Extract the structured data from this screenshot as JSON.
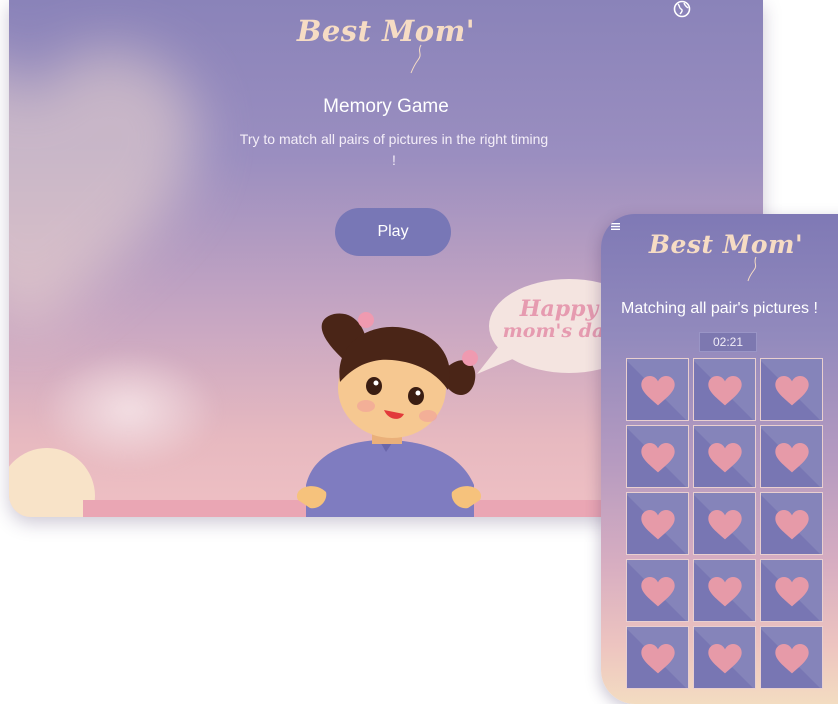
{
  "brand": {
    "logo": "Best Mom'"
  },
  "tablet": {
    "title": "Memory Game",
    "description": "Try to match all pairs of pictures in the right timing !",
    "play_label": "Play",
    "bubble_line1": "Happy",
    "bubble_line2": "mom's day"
  },
  "phone": {
    "title": "Matching all pair's pictures !",
    "timer": "02:21",
    "cards": [
      {
        "icon": "heart-icon"
      },
      {
        "icon": "heart-icon"
      },
      {
        "icon": "heart-icon"
      },
      {
        "icon": "heart-icon"
      },
      {
        "icon": "heart-icon"
      },
      {
        "icon": "heart-icon"
      },
      {
        "icon": "heart-icon"
      },
      {
        "icon": "heart-icon"
      },
      {
        "icon": "heart-icon"
      },
      {
        "icon": "heart-icon"
      },
      {
        "icon": "heart-icon"
      },
      {
        "icon": "heart-icon"
      },
      {
        "icon": "heart-icon"
      },
      {
        "icon": "heart-icon"
      },
      {
        "icon": "heart-icon"
      }
    ]
  },
  "colors": {
    "accent": "#7877b6",
    "logo": "#f6dcc4",
    "heart": "#e69aa8",
    "card": "#7876b3"
  }
}
